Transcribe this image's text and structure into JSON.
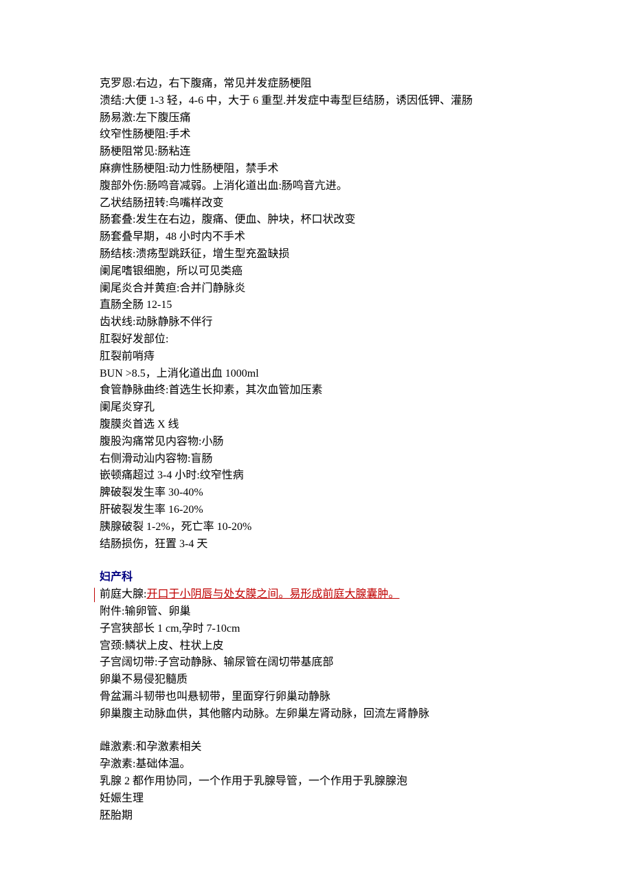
{
  "section1": [
    "克罗恩:右边，右下腹痛，常见并发症肠梗阻",
    "溃结:大便 1-3 轻，4-6 中，大于 6 重型.并发症中毒型巨结肠，诱因低钾、灌肠",
    "肠易激:左下腹压痛",
    "纹窄性肠梗阻:手术",
    "肠梗阻常见:肠粘连",
    "麻痹性肠梗阻:动力性肠梗阻，禁手术",
    "腹部外伤:肠鸣音减弱。上消化道出血:肠鸣音亢进。",
    "乙状结肠扭转:鸟嘴样改变",
    "肠套叠:发生在右边，腹痛、便血、肿块，杯口状改变",
    "肠套叠早期，48 小时内不手术",
    "肠结核:溃疡型跳跃征，增生型充盈缺损",
    "阑尾嗜银细胞，所以可见类癌",
    "阑尾炎合并黄疸:合并门静脉炎",
    "直肠全肠 12-15",
    "齿状线:动脉静脉不伴行",
    "肛裂好发部位:",
    "肛裂前哨痔",
    "BUN >8.5，上消化道出血 1000ml",
    "食管静脉曲终:首选生长抑素，其次血管加压素",
    "阑尾炎穿孔",
    "腹膜炎首选 X 线",
    "腹股沟痛常见内容物:小肠",
    "右侧滑动汕内容物:盲肠",
    "嵌顿痛超过 3-4 小时:纹窄性病",
    "脾破裂发生率 30-40%",
    "肝破裂发生率 16-20%",
    "胰腺破裂 1-2%，死亡率 10-20%",
    "结肠损伤，狂置 3-4 天"
  ],
  "section2_title": "妇产科",
  "line_a_prefix": "前庭大腺:",
  "line_a_highlight": "开口于小阴唇与处女膜之间。易形成前庭大腺囊肿。",
  "section2_rest": [
    "附件:输卵管、卵巢",
    "子宫狭部长 1 cm,孕时 7-10cm",
    "宫颈:鳞状上皮、柱状上皮",
    "子宫阔切带:子宫动静脉、输尿管在阔切带基底部",
    "卵巢不易侵犯髓质",
    "骨盆漏斗韧带也叫悬韧带，里面穿行卵巢动静脉",
    "卵巢腹主动脉血供，其他髂内动脉。左卵巢左肾动脉，回流左肾静脉"
  ],
  "section3": [
    "雌激素:和孕激素相关",
    "孕激素:基础体温。",
    "乳腺 2 都作用协同，一个作用于乳腺导管，一个作用于乳腺腺泡",
    "妊娠生理",
    "胚胎期"
  ]
}
